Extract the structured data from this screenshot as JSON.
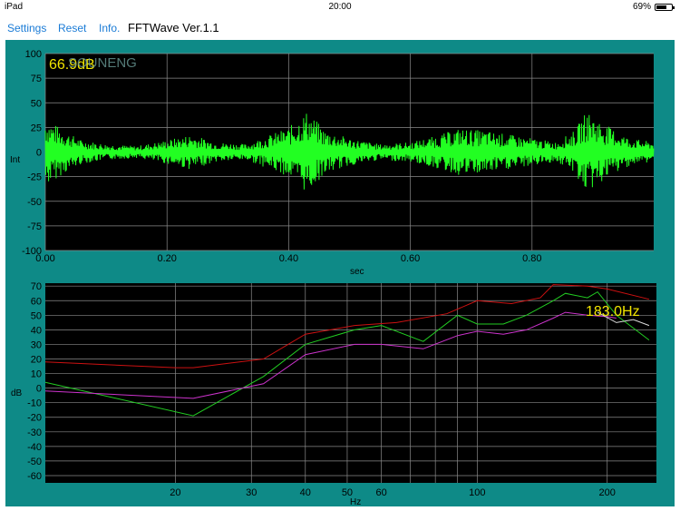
{
  "status": {
    "device": "iPad",
    "time": "20:00",
    "battery": "69%",
    "battery_level": 0.69
  },
  "nav": {
    "settings": "Settings",
    "reset": "Reset",
    "info": "Info.",
    "title": "FFTWave Ver.1.1"
  },
  "colors": {
    "panel": "#0e8a87",
    "plot_bg": "#000000",
    "wave": "#22ff22",
    "readout": "#f2e600",
    "red": "#cc1111",
    "green": "#22cc22",
    "magenta": "#cc33cc",
    "gray": "#dddddd"
  },
  "waveform": {
    "readout": "66.9dB",
    "watermark": "SOUNENG",
    "ylabel": "Int",
    "xlabel": "sec",
    "yticks": [
      "100",
      "75",
      "50",
      "25",
      "0",
      "-25",
      "-50",
      "-75",
      "-100"
    ],
    "xticks": [
      "0.00",
      "0.20",
      "0.40",
      "0.60",
      "0.80"
    ]
  },
  "spectrum": {
    "readout": "183.0Hz",
    "ylabel": "dB",
    "xlabel": "Hz",
    "yticks": [
      "70",
      "60",
      "50",
      "40",
      "30",
      "20",
      "10",
      "0",
      "-10",
      "-20",
      "-30",
      "-40",
      "-50",
      "-60"
    ],
    "xticks": [
      "20",
      "30",
      "40",
      "50",
      "60",
      "100",
      "200"
    ]
  },
  "chart_data": [
    {
      "type": "line",
      "title": "",
      "xlabel": "sec",
      "ylabel": "Int",
      "xlim": [
        0,
        1.0
      ],
      "ylim": [
        -100,
        100
      ],
      "grid": true,
      "series": [
        {
          "color": "#22ff22",
          "envelope": [
            {
              "t": 0.0,
              "amp": 35
            },
            {
              "t": 0.03,
              "amp": 22
            },
            {
              "t": 0.06,
              "amp": 12
            },
            {
              "t": 0.1,
              "amp": 8
            },
            {
              "t": 0.15,
              "amp": 6
            },
            {
              "t": 0.2,
              "amp": 12
            },
            {
              "t": 0.24,
              "amp": 18
            },
            {
              "t": 0.28,
              "amp": 10
            },
            {
              "t": 0.33,
              "amp": 8
            },
            {
              "t": 0.4,
              "amp": 25
            },
            {
              "t": 0.43,
              "amp": 42
            },
            {
              "t": 0.46,
              "amp": 22
            },
            {
              "t": 0.5,
              "amp": 14
            },
            {
              "t": 0.55,
              "amp": 8
            },
            {
              "t": 0.6,
              "amp": 10
            },
            {
              "t": 0.64,
              "amp": 16
            },
            {
              "t": 0.68,
              "amp": 24
            },
            {
              "t": 0.72,
              "amp": 22
            },
            {
              "t": 0.76,
              "amp": 18
            },
            {
              "t": 0.8,
              "amp": 14
            },
            {
              "t": 0.84,
              "amp": 10
            },
            {
              "t": 0.87,
              "amp": 22
            },
            {
              "t": 0.89,
              "amp": 42
            },
            {
              "t": 0.92,
              "amp": 28
            },
            {
              "t": 0.96,
              "amp": 14
            },
            {
              "t": 1.0,
              "amp": 10
            }
          ]
        }
      ]
    },
    {
      "type": "line",
      "title": "",
      "xlabel": "Hz",
      "ylabel": "dB",
      "xscale": "log",
      "xlim": [
        10,
        260
      ],
      "ylim": [
        -65,
        72
      ],
      "grid": true,
      "series": [
        {
          "color": "#cc1111",
          "x": [
            10,
            14,
            20,
            22,
            32,
            40,
            52,
            65,
            85,
            100,
            120,
            140,
            150,
            180,
            200,
            250
          ],
          "y": [
            18,
            16,
            14,
            14,
            20,
            37,
            43,
            45,
            51,
            60,
            58,
            62,
            71,
            70,
            68,
            61
          ]
        },
        {
          "color": "#22cc22",
          "x": [
            10,
            22,
            32,
            40,
            52,
            60,
            75,
            90,
            100,
            115,
            130,
            150,
            160,
            180,
            190,
            210,
            250
          ],
          "y": [
            4,
            -19,
            8,
            30,
            40,
            43,
            32,
            50,
            44,
            44,
            50,
            60,
            65,
            62,
            66,
            50,
            33
          ]
        },
        {
          "color": "#cc33cc",
          "x": [
            10,
            22,
            32,
            40,
            52,
            60,
            75,
            90,
            100,
            115,
            130,
            150,
            160,
            180,
            200,
            210
          ],
          "y": [
            -2,
            -7,
            3,
            23,
            30,
            30,
            27,
            36,
            39,
            37,
            40,
            48,
            52,
            50,
            49,
            48
          ]
        },
        {
          "color": "#dddddd",
          "x": [
            190,
            210,
            230,
            250
          ],
          "y": [
            52,
            45,
            47,
            43
          ]
        }
      ]
    }
  ]
}
